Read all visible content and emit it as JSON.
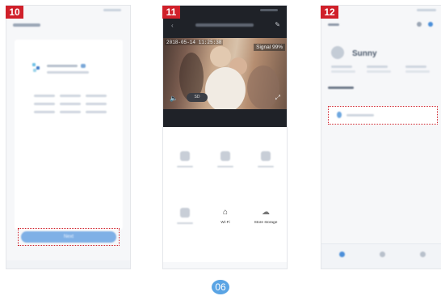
{
  "steps": [
    {
      "badge": "10",
      "button_label": "Next"
    },
    {
      "badge": "11",
      "video": {
        "timestamp": "2018-05-14 11:25:38",
        "signal": "Signal 99%",
        "sd_label": "SD"
      },
      "controls": {
        "labels": [
          "",
          "",
          "",
          "",
          "Wi-Fi",
          "Store storage"
        ]
      }
    },
    {
      "badge": "12",
      "home_name": "Sunny"
    }
  ],
  "page_number": "06",
  "colors": {
    "badge": "#d0202a",
    "accent": "#5aa4e4",
    "highlight_outline": "#d0202a"
  }
}
